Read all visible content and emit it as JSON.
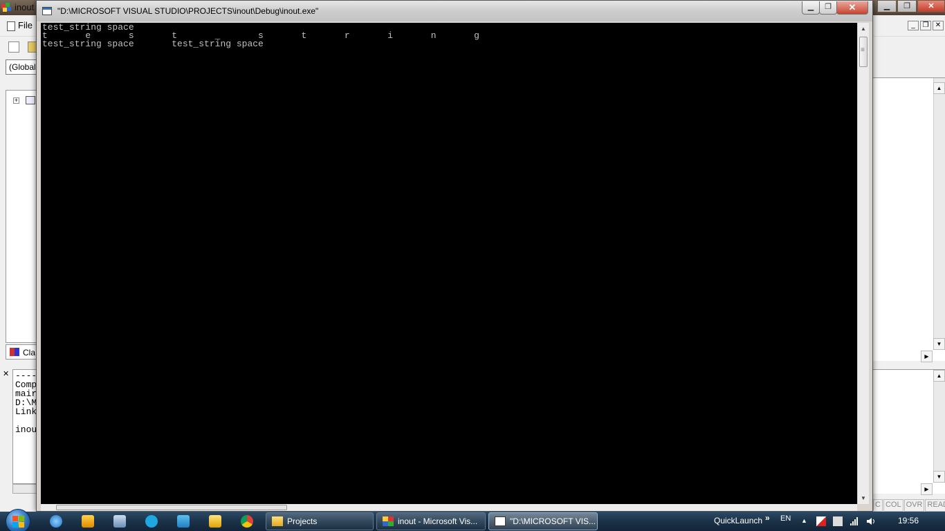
{
  "ide": {
    "title": "inout",
    "menu_file": "File",
    "scope_combo": "(Globals",
    "workspace_tab": "Cla",
    "output_lines": [
      "----",
      "Comp",
      "mair",
      "D:\\M",
      "Link",
      "",
      "inou"
    ],
    "status_cells": [
      "C",
      "COL",
      "OVR",
      "READ"
    ]
  },
  "console": {
    "title": "\"D:\\MICROSOFT VISUAL STUDIO\\PROJECTS\\inout\\Debug\\inout.exe\"",
    "lines": [
      "test_string space",
      "t       e       s       t       _       s       t       r       i       n       g",
      "test_string space       test_string space"
    ]
  },
  "taskbar": {
    "items": [
      {
        "label": "Projects"
      },
      {
        "label": "inout - Microsoft Vis..."
      },
      {
        "label": "\"D:\\MICROSOFT VIS..."
      }
    ],
    "quicklaunch": "QuickLaunch",
    "ql_more": "»",
    "language": "EN",
    "clock": "19:56"
  },
  "colors": {
    "console_bg": "#000000",
    "console_text": "#c0c0c0",
    "taskbar": "#1b3247"
  }
}
